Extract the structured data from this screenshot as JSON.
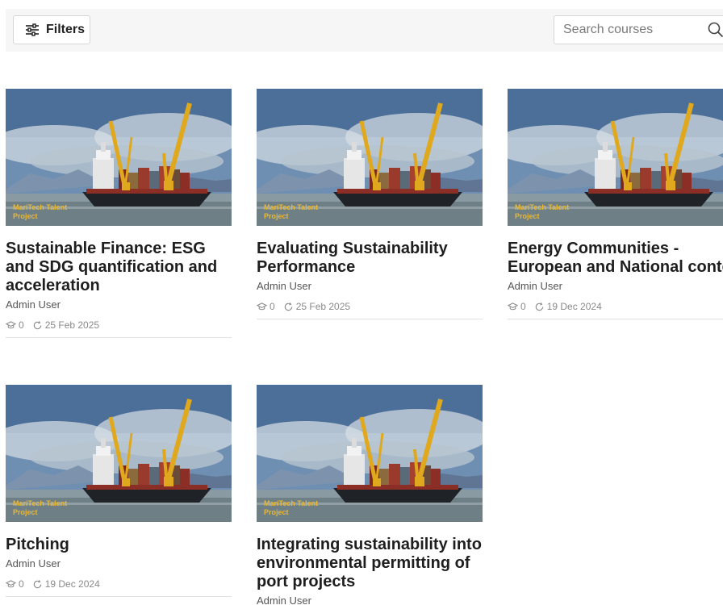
{
  "toolbar": {
    "filters_label": "Filters",
    "search_placeholder": "Search courses"
  },
  "cards": [
    {
      "badge_line1": "MariTech Talent",
      "badge_line2": "Project",
      "title": "Sustainable Finance: ESG and SDG quantification and acceleration",
      "author": "Admin User",
      "enrolled": "0",
      "date": "25 Feb 2025"
    },
    {
      "badge_line1": "MariTech Talent",
      "badge_line2": "Project",
      "title": "Evaluating Sustainability  Performance",
      "author": "Admin User",
      "enrolled": "0",
      "date": "25 Feb 2025"
    },
    {
      "badge_line1": "MariTech Talent",
      "badge_line2": "Project",
      "title": "Energy Communities - European and National context",
      "author": "Admin User",
      "enrolled": "0",
      "date": "19 Dec 2024"
    },
    {
      "badge_line1": "MariTech Talent",
      "badge_line2": "Project",
      "title": "Pitching",
      "author": "Admin User",
      "enrolled": "0",
      "date": "19 Dec 2024"
    },
    {
      "badge_line1": "MariTech Talent",
      "badge_line2": "Project",
      "title": "Integrating sustainability into environmental permitting of port projects",
      "author": "Admin User",
      "enrolled": "",
      "date": ""
    }
  ]
}
